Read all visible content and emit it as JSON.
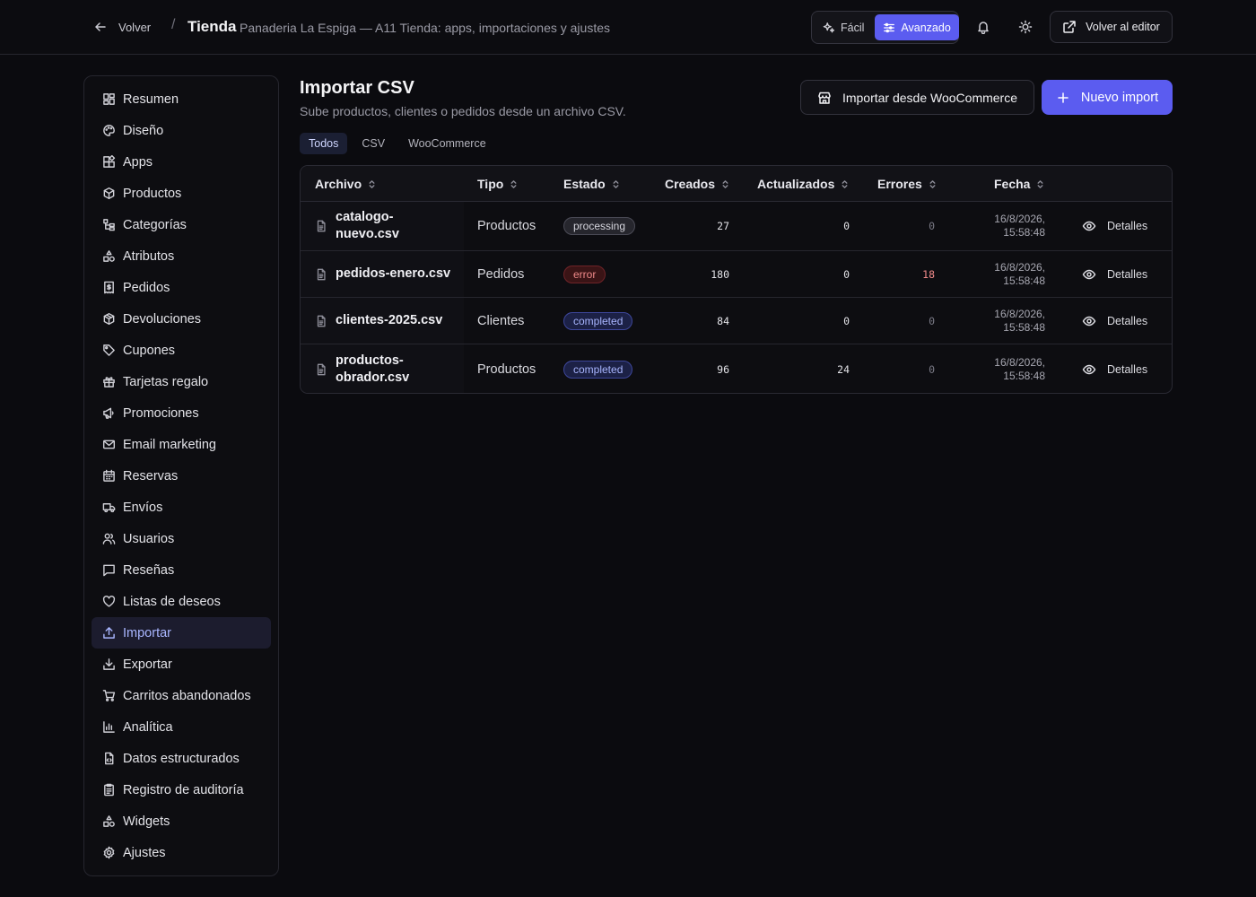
{
  "topbar": {
    "back_label": "Volver",
    "separator": "/",
    "title": "Tienda",
    "subtitle": "Panaderia La Espiga — A11 Tienda: apps, importaciones y ajustes",
    "mode_easy": "Fácil",
    "mode_advanced": "Avanzado",
    "active_mode": "Avanzado",
    "editor_label": "Volver al editor"
  },
  "sidebar": {
    "active": "Importar",
    "items": [
      {
        "label": "Resumen",
        "icon": "dashboard-icon"
      },
      {
        "label": "Diseño",
        "icon": "palette-icon"
      },
      {
        "label": "Apps",
        "icon": "apps-icon"
      },
      {
        "label": "Productos",
        "icon": "box-icon"
      },
      {
        "label": "Categorías",
        "icon": "category-tree-icon"
      },
      {
        "label": "Atributos",
        "icon": "shapes-icon"
      },
      {
        "label": "Pedidos",
        "icon": "receipt-icon"
      },
      {
        "label": "Devoluciones",
        "icon": "return-box-icon"
      },
      {
        "label": "Cupones",
        "icon": "tag-icon"
      },
      {
        "label": "Tarjetas regalo",
        "icon": "gift-icon"
      },
      {
        "label": "Promociones",
        "icon": "megaphone-icon"
      },
      {
        "label": "Email marketing",
        "icon": "mail-icon"
      },
      {
        "label": "Reservas",
        "icon": "calendar-icon"
      },
      {
        "label": "Envíos",
        "icon": "truck-icon"
      },
      {
        "label": "Usuarios",
        "icon": "users-icon"
      },
      {
        "label": "Reseñas",
        "icon": "message-icon"
      },
      {
        "label": "Listas de deseos",
        "icon": "heart-icon"
      },
      {
        "label": "Importar",
        "icon": "upload-icon"
      },
      {
        "label": "Exportar",
        "icon": "download-icon"
      },
      {
        "label": "Carritos abandonados",
        "icon": "cart-icon"
      },
      {
        "label": "Analítica",
        "icon": "bar-chart-icon"
      },
      {
        "label": "Datos estructurados",
        "icon": "code-file-icon"
      },
      {
        "label": "Registro de auditoría",
        "icon": "clipboard-icon"
      },
      {
        "label": "Widgets",
        "icon": "widgets-icon"
      },
      {
        "label": "Ajustes",
        "icon": "gear-icon"
      }
    ]
  },
  "main": {
    "title": "Importar CSV",
    "subtitle": "Sube productos, clientes o pedidos desde un archivo CSV.",
    "woo_button": "Importar desde WooCommerce",
    "new_button": "Nuevo import",
    "filters": [
      "Todos",
      "CSV",
      "WooCommerce"
    ],
    "active_filter": "Todos"
  },
  "table": {
    "columns": {
      "file": "Archivo",
      "type": "Tipo",
      "status": "Estado",
      "created": "Creados",
      "updated": "Actualizados",
      "errors": "Errores",
      "date": "Fecha"
    },
    "details_label": "Detalles",
    "rows": [
      {
        "file_line1": "catalogo-",
        "file_line2": "nuevo.csv",
        "type": "Productos",
        "status": "processing",
        "created": "27",
        "updated": "0",
        "errors": "0",
        "date_line1": "16/8/2026,",
        "date_line2": "15:58:48"
      },
      {
        "file_line1": "pedidos-enero.csv",
        "file_line2": "",
        "type": "Pedidos",
        "status": "error",
        "created": "180",
        "updated": "0",
        "errors": "18",
        "date_line1": "16/8/2026,",
        "date_line2": "15:58:48"
      },
      {
        "file_line1": "clientes-2025.csv",
        "file_line2": "",
        "type": "Clientes",
        "status": "completed",
        "created": "84",
        "updated": "0",
        "errors": "0",
        "date_line1": "16/8/2026,",
        "date_line2": "15:58:48"
      },
      {
        "file_line1": "productos-",
        "file_line2": "obrador.csv",
        "type": "Productos",
        "status": "completed",
        "created": "96",
        "updated": "24",
        "errors": "0",
        "date_line1": "16/8/2026,",
        "date_line2": "15:58:48"
      }
    ]
  },
  "colors": {
    "accent": "#5b5cf0",
    "background": "#0b0b0f",
    "error": "#f08a8a"
  }
}
